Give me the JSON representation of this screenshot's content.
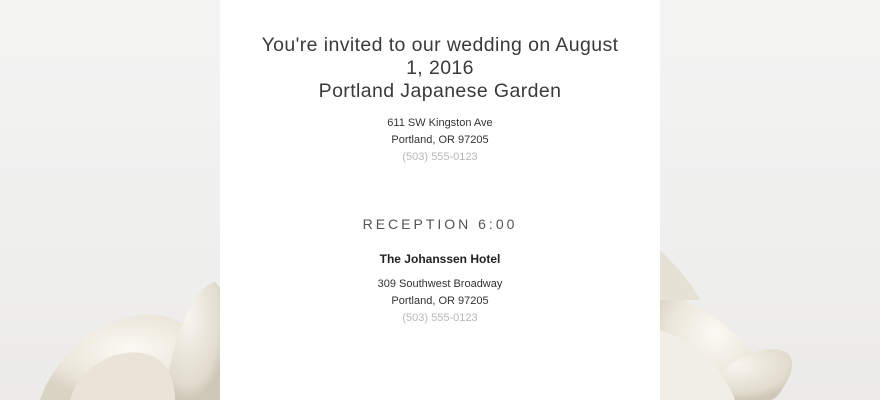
{
  "invitation": {
    "headline_line1": "You're invited to our wedding on August",
    "headline_line2": "1, 2016",
    "venue": "Portland Japanese Garden",
    "ceremony_address": {
      "street": "611 SW Kingston Ave",
      "city": "Portland, OR 97205",
      "phone": "(503) 555-0123"
    }
  },
  "reception": {
    "heading": "RECEPTION 6:00",
    "venue": "The Johanssen Hotel",
    "address": {
      "street": "309 Southwest Broadway",
      "city": "Portland, OR 97205",
      "phone": "(503) 555-0123"
    }
  },
  "colors": {
    "card_background": "#ffffff",
    "page_background": "#f2f2f1",
    "text_primary": "#333333",
    "text_muted": "#b8b8b8"
  }
}
